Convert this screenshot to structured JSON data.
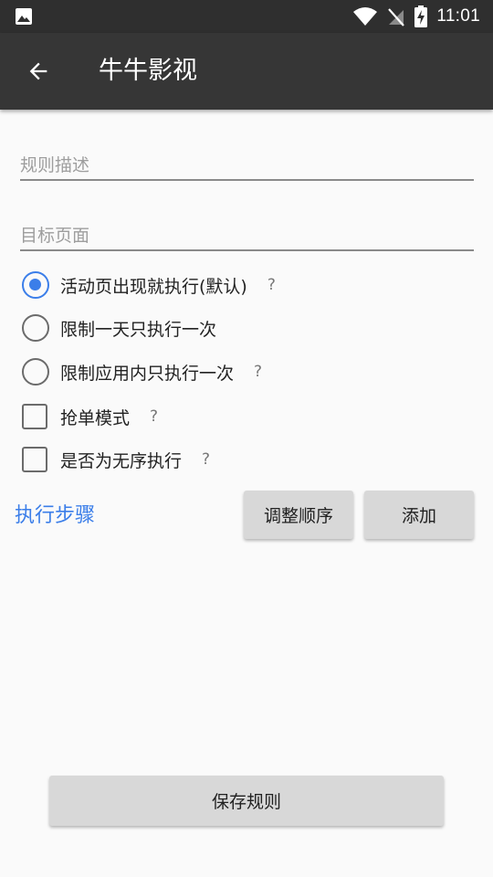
{
  "status_bar": {
    "time": "11:01",
    "icons": [
      "image-icon",
      "wifi-icon",
      "no-signal-icon",
      "battery-charging-icon"
    ]
  },
  "app_bar": {
    "title": "牛牛影视",
    "back_icon": "arrow-back-icon"
  },
  "form": {
    "rule_description": {
      "placeholder": "规则描述",
      "value": ""
    },
    "target_page": {
      "placeholder": "目标页面",
      "value": ""
    },
    "radio_options": [
      {
        "label": "活动页出现就执行(默认)",
        "selected": true,
        "help": "?"
      },
      {
        "label": "限制一天只执行一次",
        "selected": false,
        "help": ""
      },
      {
        "label": "限制应用内只执行一次",
        "selected": false,
        "help": "?"
      }
    ],
    "checkboxes": [
      {
        "label": "抢单模式",
        "checked": false,
        "help": "?"
      },
      {
        "label": "是否为无序执行",
        "checked": false,
        "help": "?"
      }
    ]
  },
  "steps": {
    "title": "执行步骤",
    "reorder_label": "调整顺序",
    "add_label": "添加"
  },
  "footer": {
    "save_label": "保存规则"
  },
  "colors": {
    "accent": "#3b7ee9",
    "app_bar": "#363636",
    "status_bar": "#2f2f2f",
    "button": "#d8d8d8"
  }
}
